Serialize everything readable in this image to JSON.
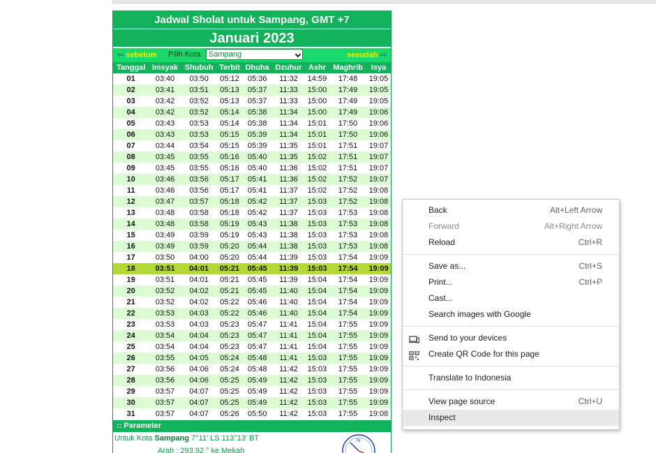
{
  "page": {
    "title": "Jadwal Sholat untuk Sampang, GMT +7",
    "month": "Januari 2023"
  },
  "nav": {
    "prev_label": "sebelum",
    "next_label": "sesudah",
    "prev_icon": "arrow-left-icon",
    "next_icon": "arrow-right-icon",
    "city_label": "Pilih Kota",
    "city_selected": "Sampang"
  },
  "table": {
    "headers": [
      "Tanggal",
      "Imsyak",
      "Shubuh",
      "Terbit",
      "Dhuha",
      "Dzuhur",
      "Ashr",
      "Maghrib",
      "Isya"
    ],
    "today_row": "18",
    "rows": [
      [
        "01",
        "03:40",
        "03:50",
        "05:12",
        "05:36",
        "11:32",
        "14:59",
        "17:48",
        "19:05"
      ],
      [
        "02",
        "03:41",
        "03:51",
        "05:13",
        "05:37",
        "11:33",
        "15:00",
        "17:49",
        "19:05"
      ],
      [
        "03",
        "03:42",
        "03:52",
        "05:13",
        "05:37",
        "11:33",
        "15:00",
        "17:49",
        "19:05"
      ],
      [
        "04",
        "03:42",
        "03:52",
        "05:14",
        "05:38",
        "11:34",
        "15:00",
        "17:49",
        "19:06"
      ],
      [
        "05",
        "03:43",
        "03:53",
        "05:14",
        "05:38",
        "11:34",
        "15:01",
        "17:50",
        "19:06"
      ],
      [
        "06",
        "03:43",
        "03:53",
        "05:15",
        "05:39",
        "11:34",
        "15:01",
        "17:50",
        "19:06"
      ],
      [
        "07",
        "03:44",
        "03:54",
        "05:15",
        "05:39",
        "11:35",
        "15:01",
        "17:51",
        "19:07"
      ],
      [
        "08",
        "03:45",
        "03:55",
        "05:16",
        "05:40",
        "11:35",
        "15:02",
        "17:51",
        "19:07"
      ],
      [
        "09",
        "03:45",
        "03:55",
        "05:16",
        "05:40",
        "11:36",
        "15:02",
        "17:51",
        "19:07"
      ],
      [
        "10",
        "03:46",
        "03:56",
        "05:17",
        "05:41",
        "11:36",
        "15:02",
        "17:52",
        "19:07"
      ],
      [
        "11",
        "03:46",
        "03:56",
        "05:17",
        "05:41",
        "11:37",
        "15:02",
        "17:52",
        "19:08"
      ],
      [
        "12",
        "03:47",
        "03:57",
        "05:18",
        "05:42",
        "11:37",
        "15:03",
        "17:52",
        "19:08"
      ],
      [
        "13",
        "03:48",
        "03:58",
        "05:18",
        "05:42",
        "11:37",
        "15:03",
        "17:53",
        "19:08"
      ],
      [
        "14",
        "03:48",
        "03:58",
        "05:19",
        "05:43",
        "11:38",
        "15:03",
        "17:53",
        "19:08"
      ],
      [
        "15",
        "03:49",
        "03:59",
        "05:19",
        "05:43",
        "11:38",
        "15:03",
        "17:53",
        "19:08"
      ],
      [
        "16",
        "03:49",
        "03:59",
        "05:20",
        "05:44",
        "11:38",
        "15:03",
        "17:53",
        "19:08"
      ],
      [
        "17",
        "03:50",
        "04:00",
        "05:20",
        "05:44",
        "11:39",
        "15:03",
        "17:54",
        "19:09"
      ],
      [
        "18",
        "03:51",
        "04:01",
        "05:21",
        "05:45",
        "11:39",
        "15:03",
        "17:54",
        "19:09"
      ],
      [
        "19",
        "03:51",
        "04:01",
        "05:21",
        "05:45",
        "11:39",
        "15:04",
        "17:54",
        "19:09"
      ],
      [
        "20",
        "03:52",
        "04:02",
        "05:21",
        "05:45",
        "11:40",
        "15:04",
        "17:54",
        "19:09"
      ],
      [
        "21",
        "03:52",
        "04:02",
        "05:22",
        "05:46",
        "11:40",
        "15:04",
        "17:54",
        "19:09"
      ],
      [
        "22",
        "03:53",
        "04:03",
        "05:22",
        "05:46",
        "11:40",
        "15:04",
        "17:54",
        "19:09"
      ],
      [
        "23",
        "03:53",
        "04:03",
        "05:23",
        "05:47",
        "11:41",
        "15:04",
        "17:55",
        "19:09"
      ],
      [
        "24",
        "03:54",
        "04:04",
        "05:23",
        "05:47",
        "11:41",
        "15:04",
        "17:55",
        "19:09"
      ],
      [
        "25",
        "03:54",
        "04:04",
        "05:23",
        "05:47",
        "11:41",
        "15:04",
        "17:55",
        "19:09"
      ],
      [
        "26",
        "03:55",
        "04:05",
        "05:24",
        "05:48",
        "11:41",
        "15:03",
        "17:55",
        "19:09"
      ],
      [
        "27",
        "03:56",
        "04:06",
        "05:24",
        "05:48",
        "11:42",
        "15:03",
        "17:55",
        "19:09"
      ],
      [
        "28",
        "03:56",
        "04:06",
        "05:25",
        "05:49",
        "11:42",
        "15:03",
        "17:55",
        "19:09"
      ],
      [
        "29",
        "03:57",
        "04:07",
        "05:25",
        "05:49",
        "11:42",
        "15:03",
        "17:55",
        "19:09"
      ],
      [
        "30",
        "03:57",
        "04:07",
        "05:25",
        "05:49",
        "11:42",
        "15:03",
        "17:55",
        "19:09"
      ],
      [
        "31",
        "03:57",
        "04:07",
        "05:26",
        "05:50",
        "11:42",
        "15:03",
        "17:55",
        "19:08"
      ]
    ]
  },
  "parameter": {
    "header": ":: Parameter",
    "prefix": "Untuk Kota",
    "city": "Sampang",
    "coords": "7°11' LS 113°13' BT",
    "direction": "Arah : 293.92 ° ke Mekah",
    "compass_icon": "qibla-compass-icon"
  },
  "context_menu": {
    "groups": [
      [
        {
          "label": "Back",
          "shortcut": "Alt+Left Arrow",
          "disabled": false
        },
        {
          "label": "Forward",
          "shortcut": "Alt+Right Arrow",
          "disabled": true
        },
        {
          "label": "Reload",
          "shortcut": "Ctrl+R",
          "disabled": false
        }
      ],
      [
        {
          "label": "Save as...",
          "shortcut": "Ctrl+S"
        },
        {
          "label": "Print...",
          "shortcut": "Ctrl+P"
        },
        {
          "label": "Cast...",
          "shortcut": ""
        },
        {
          "label": "Search images with Google",
          "shortcut": ""
        }
      ],
      [
        {
          "label": "Send to your devices",
          "shortcut": "",
          "icon": "devices-icon"
        },
        {
          "label": "Create QR Code for this page",
          "shortcut": "",
          "icon": "qr-code-icon"
        }
      ],
      [
        {
          "label": "Translate to Indonesia",
          "shortcut": ""
        }
      ],
      [
        {
          "label": "View page source",
          "shortcut": "Ctrl+U"
        },
        {
          "label": "Inspect",
          "shortcut": "",
          "hovered": true
        }
      ]
    ]
  },
  "colors": {
    "header_green": "#11b25a",
    "nav_green": "#19d96a",
    "row_alt": "#dcfcd4",
    "today_highlight": "#b3d83a",
    "nav_link": "#f3f000"
  }
}
